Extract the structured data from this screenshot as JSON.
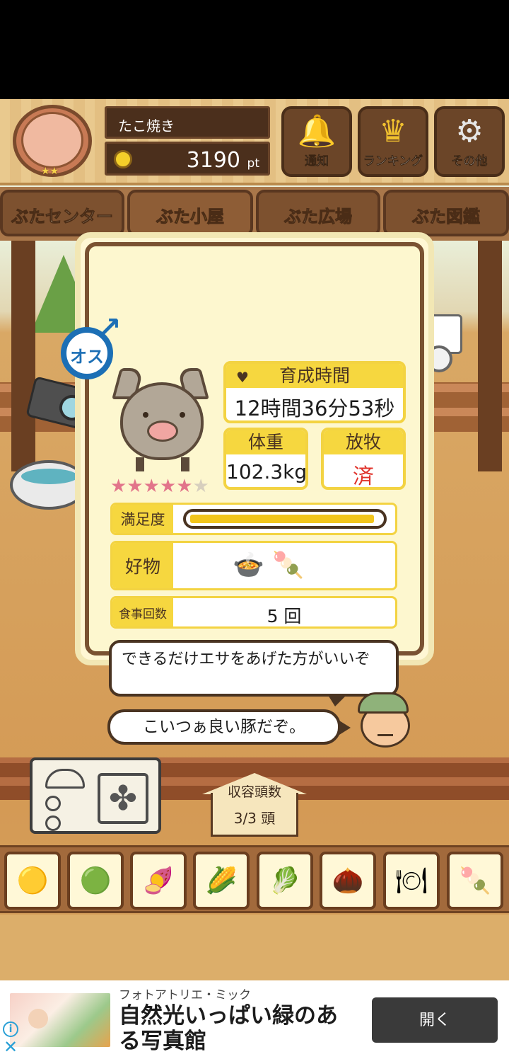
{
  "header": {
    "player_name": "たこ焼き",
    "points_value": "3190",
    "points_unit": "pt",
    "buttons": [
      {
        "label": "通知",
        "icon": "bell-icon"
      },
      {
        "label": "ランキング",
        "icon": "crown-icon"
      },
      {
        "label": "その他",
        "icon": "gear-icon"
      }
    ]
  },
  "tabs": [
    {
      "label": "ぶたセンター",
      "active": false
    },
    {
      "label": "ぶた小屋",
      "active": true
    },
    {
      "label": "ぶた広場",
      "active": false
    },
    {
      "label": "ぶた図鑑",
      "active": false
    }
  ],
  "pig_info": {
    "gender_label": "オス",
    "stars_filled": 5,
    "stars_total": 6,
    "raising_time_label": "育成時間",
    "raising_time_value": "12時間36分53秒",
    "weight_label": "体重",
    "weight_value": "102.3kg",
    "grazing_label": "放牧",
    "grazing_value": "済",
    "satisfaction_label": "満足度",
    "satisfaction_level": 1.0,
    "likes_label": "好物",
    "liked_foods": [
      "corn-pile-icon",
      "meatball-plate-icon"
    ],
    "meals_label": "食事回数",
    "meals_value": "5 回",
    "advice_message": "できるだけエサをあげた方がいいぞ",
    "comment_message": "こいつぁ良い豚だぞ。"
  },
  "capacity": {
    "label": "収容頭数",
    "value": "3/3 頭"
  },
  "food_items": [
    {
      "icon": "feed-pile-icon"
    },
    {
      "icon": "mixed-feed-icon"
    },
    {
      "icon": "sweet-potato-icon"
    },
    {
      "icon": "corn-icon"
    },
    {
      "icon": "vegetables-icon"
    },
    {
      "icon": "acorn-icon"
    },
    {
      "icon": "corn-plate-icon"
    },
    {
      "icon": "meatball-plate-icon"
    }
  ],
  "ad": {
    "advertiser": "フォトアトリエ・ミック",
    "headline": "自然光いっぱい緑のある写真館",
    "button_label": "開く"
  },
  "colors": {
    "accent_yellow": "#f6d73f",
    "wood_dark": "#6b4528",
    "gender_blue": "#1c6fb5",
    "grazing_red": "#e0322a",
    "star_pink": "#e2748a"
  }
}
